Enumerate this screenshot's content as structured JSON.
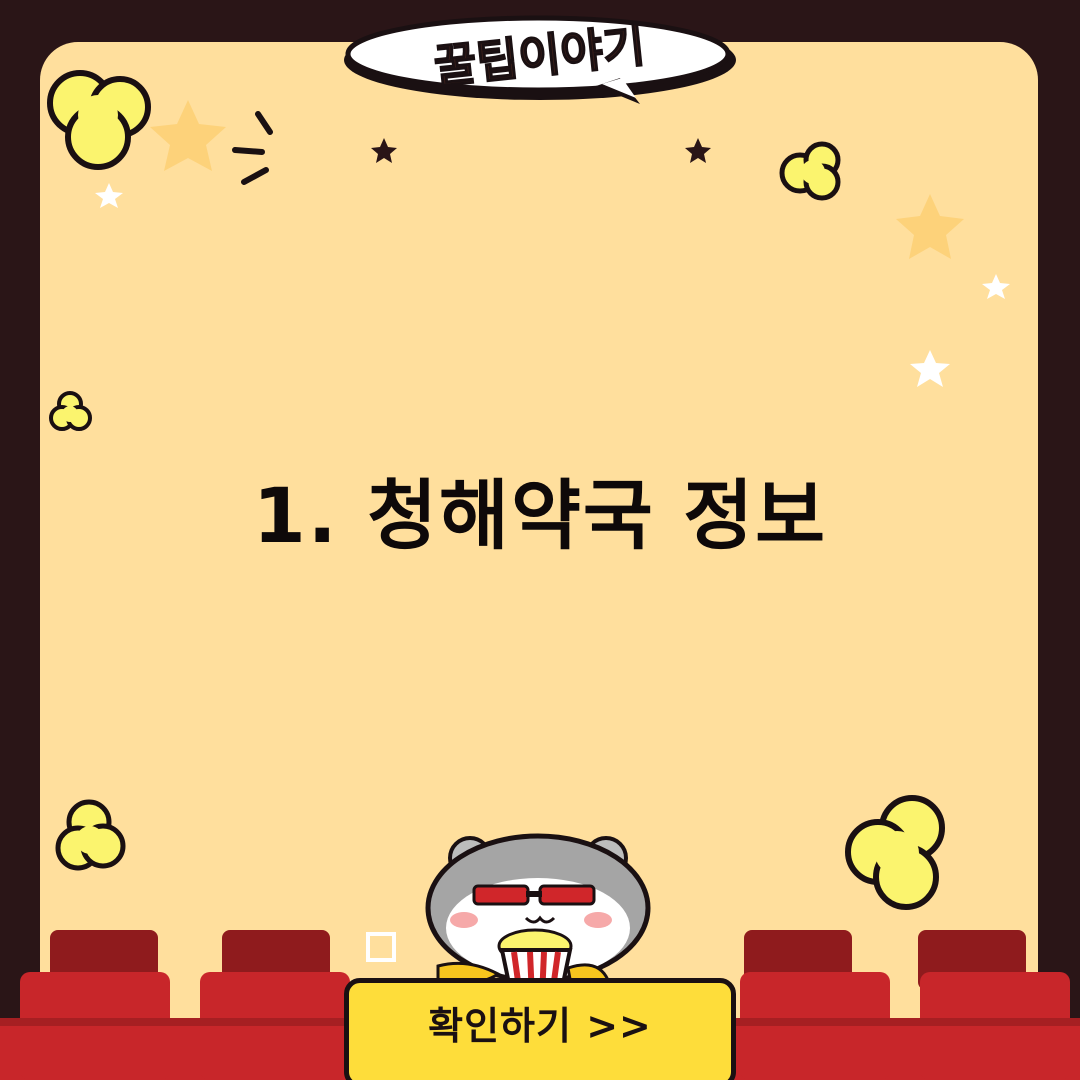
{
  "brand": {
    "logo_text": "꿀팁이야기"
  },
  "content": {
    "headline": "1. 청해약국 정보"
  },
  "cta": {
    "label": "확인하기 >>"
  },
  "icons": {
    "stars": "star-icon",
    "popcorn": "popcorn-icon",
    "mascot": "hamster-mascot",
    "seats": "theater-seats"
  },
  "colors": {
    "frame": "#2a1517",
    "panel": "#ffdf9d",
    "headline": "#0e0909",
    "button": "#fedd3a",
    "popcorn": "#fbf46e",
    "seat": "#c8262a",
    "seat_dark": "#8f1b1d"
  }
}
